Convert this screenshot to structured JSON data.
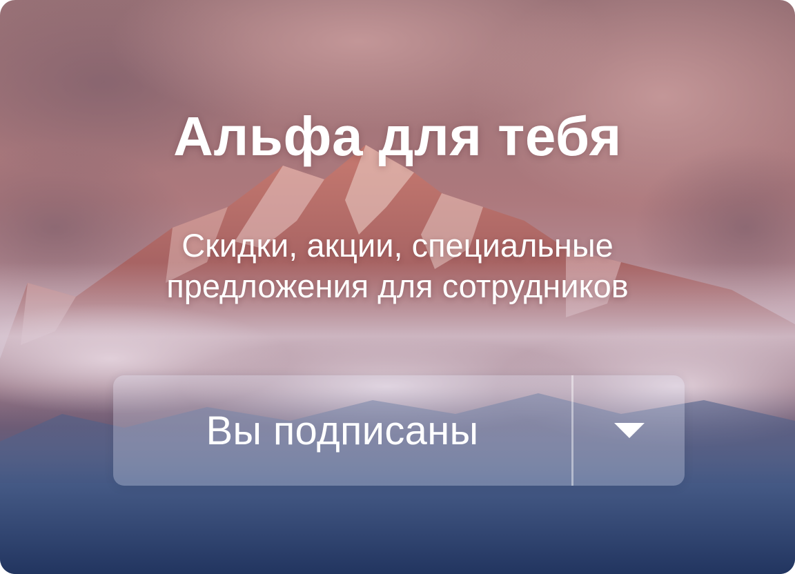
{
  "card": {
    "title": "Альфа для тебя",
    "subtitle": "Скидки, акции, специальные предложения для сотрудников",
    "background": "mountain-peak-photo"
  },
  "subscription": {
    "status_label": "Вы подписаны",
    "menu_icon": "triangle-down-icon"
  },
  "colors": {
    "sky_top": "#9a6e74",
    "sky_mid": "#b07a7c",
    "fog": "#c9b3bf",
    "valley": "#2d4370",
    "text": "#ffffff"
  }
}
